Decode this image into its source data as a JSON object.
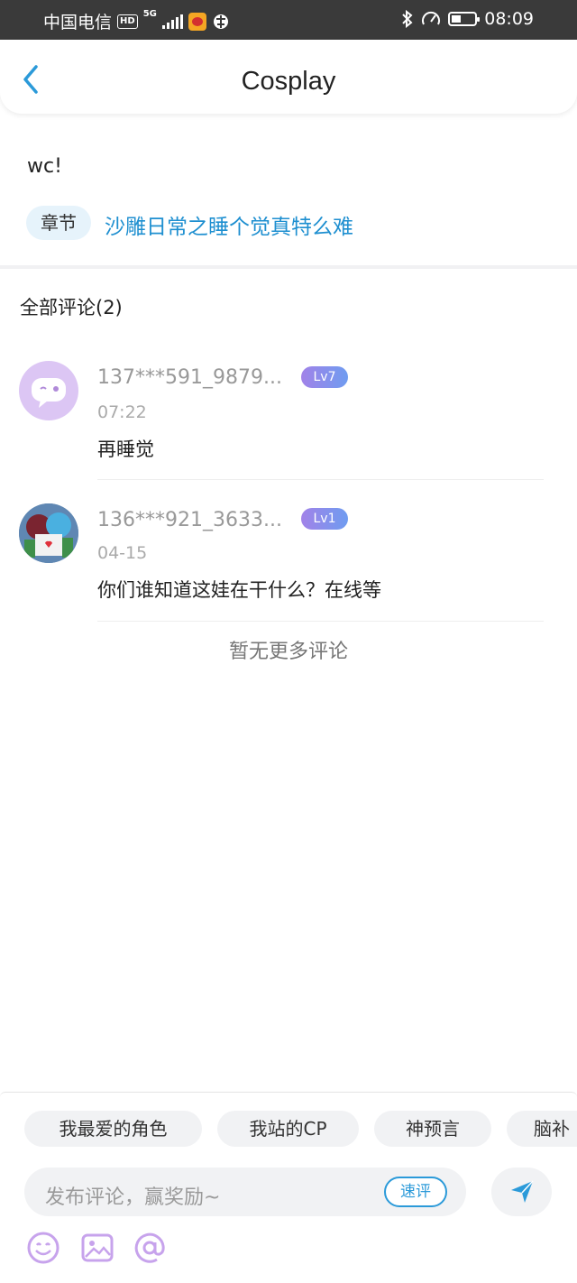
{
  "status_bar": {
    "carrier": "中国电信",
    "hd": "HD",
    "network": "5G",
    "time": "08:09"
  },
  "header": {
    "title": "Cosplay",
    "back_icon": "chevron-left-icon"
  },
  "post": {
    "text": "wc!",
    "chapter_tag": "章节",
    "chapter_title": "沙雕日常之睡个觉真特么难"
  },
  "comments_section": {
    "title": "全部评论(2)",
    "comments": [
      {
        "username": "137***591_9879...",
        "level": "Lv7",
        "time": "07:22",
        "text": "再睡觉"
      },
      {
        "username": "136***921_3633...",
        "level": "Lv1",
        "time": "04-15",
        "text": "你们谁知道这娃在干什么？在线等"
      }
    ],
    "no_more": "暂无更多评论"
  },
  "bottom_bar": {
    "quick_tags": [
      "我最爱的角色",
      "我站的CP",
      "神预言",
      "脑补"
    ],
    "input_placeholder": "发布评论，赢奖励~",
    "quick_comment": "速评",
    "icons": [
      "emoji-icon",
      "image-icon",
      "mention-icon",
      "send-icon"
    ],
    "accent_color": "#2b9ad9"
  }
}
